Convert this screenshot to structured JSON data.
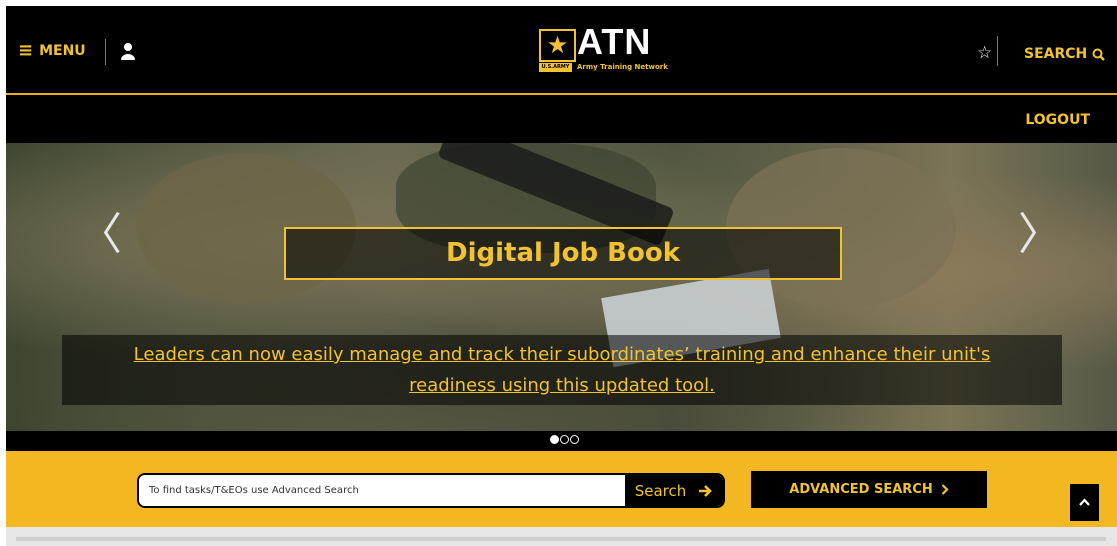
{
  "header": {
    "menu_label": "MENU",
    "logo_text": "ATN",
    "logo_badge": "U.S.ARMY",
    "logo_subtitle": "Army Training Network",
    "search_label": "SEARCH",
    "logout_label": "LOGOUT"
  },
  "hero": {
    "title": "Digital Job Book",
    "description_line1": "Leaders can now easily manage and track their subordinates’ training and enhance their unit's",
    "description_line2": "readiness using this updated tool.",
    "slide_count": 3,
    "active_slide": 1
  },
  "search": {
    "placeholder": "To find tasks/T&EOs use Advanced Search",
    "button_label": "Search",
    "advanced_label": "ADVANCED SEARCH"
  },
  "colors": {
    "gold": "#f1c232",
    "bar_yellow": "#f3b821",
    "black": "#000000"
  }
}
